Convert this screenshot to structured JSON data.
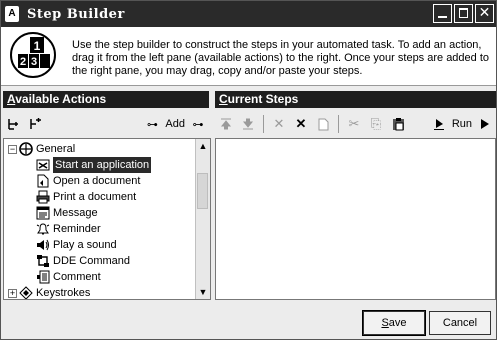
{
  "window": {
    "title": "Step Builder",
    "controls": {
      "minimize": "minimize-icon",
      "maximize": "maximize-icon",
      "close": "✕"
    }
  },
  "intro": {
    "text": "Use the step builder to construct the steps in your automated task.  To add an action, drag it from the left pane (available actions) to the right.  Once your steps are added to the right pane, you may drag, copy and/or paste your steps.",
    "icon": "step-number-icon",
    "icon_digits": [
      "1",
      "2",
      "3"
    ]
  },
  "left_pane": {
    "title_underline": "A",
    "title_rest": "vailable Actions",
    "toolbar": {
      "icons": [
        "expand-all-icon",
        "collapse-all-icon",
        "add-arrow-icon"
      ],
      "add_label": "Add"
    },
    "tree": {
      "groups": [
        {
          "label": "General",
          "expanded": true,
          "icon": "general-icon",
          "items": [
            {
              "label": "Start an application",
              "icon": "start-app-icon",
              "selected": true
            },
            {
              "label": "Open a document",
              "icon": "open-doc-icon"
            },
            {
              "label": "Print a document",
              "icon": "print-icon"
            },
            {
              "label": "Message",
              "icon": "message-icon"
            },
            {
              "label": "Reminder",
              "icon": "reminder-icon"
            },
            {
              "label": "Play a sound",
              "icon": "sound-icon"
            },
            {
              "label": "DDE Command",
              "icon": "dde-icon"
            },
            {
              "label": "Comment",
              "icon": "comment-icon"
            }
          ]
        },
        {
          "label": "Keystrokes",
          "expanded": false,
          "icon": "keystrokes-icon",
          "items": []
        }
      ]
    }
  },
  "right_pane": {
    "title_underline": "C",
    "title_rest": "urrent Steps",
    "toolbar": {
      "icons": [
        "move-up-icon",
        "move-down-icon",
        "delete-icon",
        "delete-all-icon",
        "new-icon",
        "cut-icon",
        "copy-icon",
        "paste-icon",
        "run-stop-icon"
      ],
      "run_label": "Run"
    },
    "steps": []
  },
  "footer": {
    "save_underline": "S",
    "save_rest": "ave",
    "cancel_label": "Cancel"
  }
}
